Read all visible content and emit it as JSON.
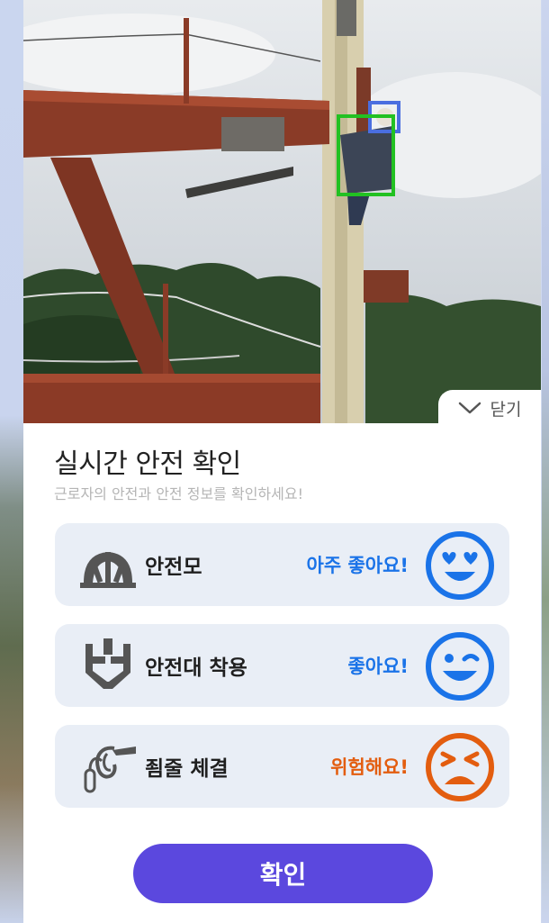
{
  "header": {
    "close_label": "닫기"
  },
  "panel": {
    "title": "실시간 안전 확인",
    "subtitle": "근로자의 안전과 안전 정보를 확인하세요!"
  },
  "checks": [
    {
      "label": "안전모",
      "status": "아주 좋아요!",
      "status_color": "#1a73e8",
      "icon": "hardhat-icon",
      "face": "heart-eyes-face-icon"
    },
    {
      "label": "안전대 착용",
      "status": "좋아요!",
      "status_color": "#1a73e8",
      "icon": "safety-harness-icon",
      "face": "winking-face-icon"
    },
    {
      "label": "죔줄 체결",
      "status": "위험해요!",
      "status_color": "#e35d0f",
      "icon": "lanyard-hook-icon",
      "face": "distressed-face-icon"
    }
  ],
  "confirm_label": "확인",
  "colors": {
    "accent": "#5b48de",
    "good": "#1a73e8",
    "danger": "#e35d0f"
  }
}
